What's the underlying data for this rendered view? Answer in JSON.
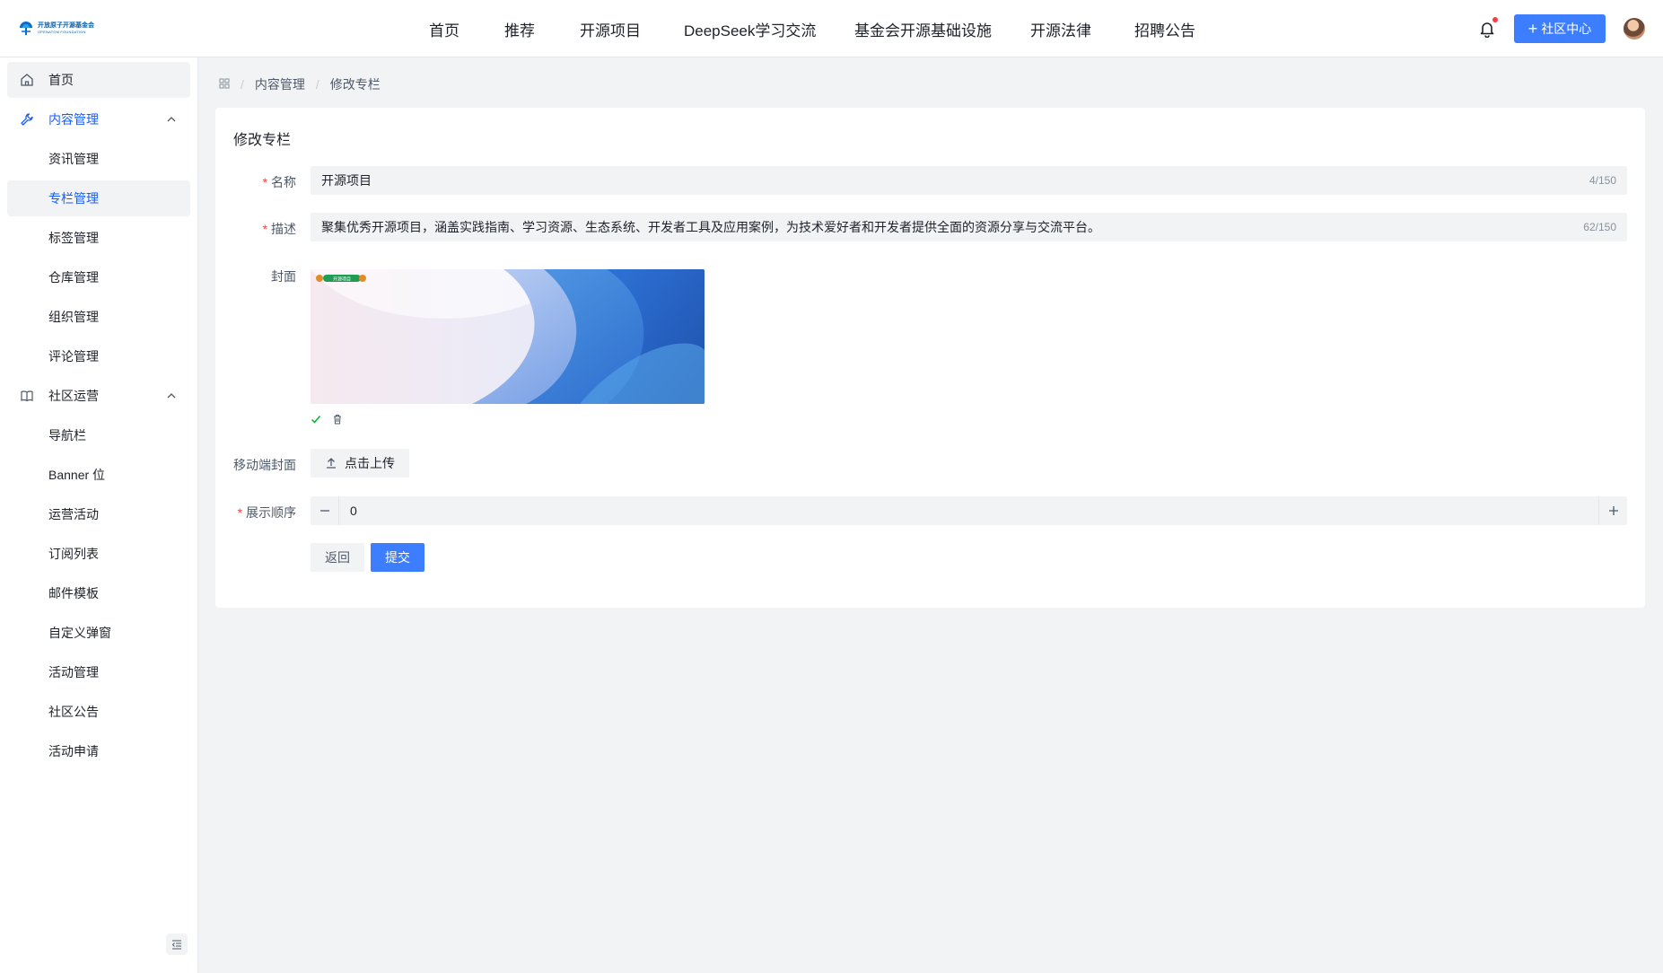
{
  "header": {
    "logo_cn": "开放原子开源基金会",
    "logo_en": "OPENATOM FOUNDATION",
    "nav": [
      "首页",
      "推荐",
      "开源项目",
      "DeepSeek学习交流",
      "基金会开源基础设施",
      "开源法律",
      "招聘公告"
    ],
    "community_button": "社区中心",
    "notification_dot_color": "#f53f3f",
    "accent": "#3c7eff"
  },
  "sidebar": {
    "home": "首页",
    "content_group": "内容管理",
    "content_items": [
      "资讯管理",
      "专栏管理",
      "标签管理",
      "仓库管理",
      "组织管理",
      "评论管理"
    ],
    "community_group": "社区运营",
    "community_items": [
      "导航栏",
      "Banner 位",
      "运营活动",
      "订阅列表",
      "邮件模板",
      "自定义弹窗",
      "活动管理",
      "社区公告",
      "活动申请"
    ]
  },
  "breadcrumb": {
    "items": [
      "内容管理",
      "修改专栏"
    ]
  },
  "form": {
    "title": "修改专栏",
    "name_label": "名称",
    "name_value": "开源项目",
    "name_count": "4/150",
    "desc_label": "描述",
    "desc_value": "聚集优秀开源项目，涵盖实践指南、学习资源、生态系统、开发者工具及应用案例，为技术爱好者和开发者提供全面的资源分享与交流平台。",
    "desc_count": "62/150",
    "cover_label": "封面",
    "cover_badge": "开源项目",
    "mobile_cover_label": "移动端封面",
    "upload_button": "点击上传",
    "order_label": "展示顺序",
    "order_value": "0",
    "back_button": "返回",
    "submit_button": "提交"
  }
}
